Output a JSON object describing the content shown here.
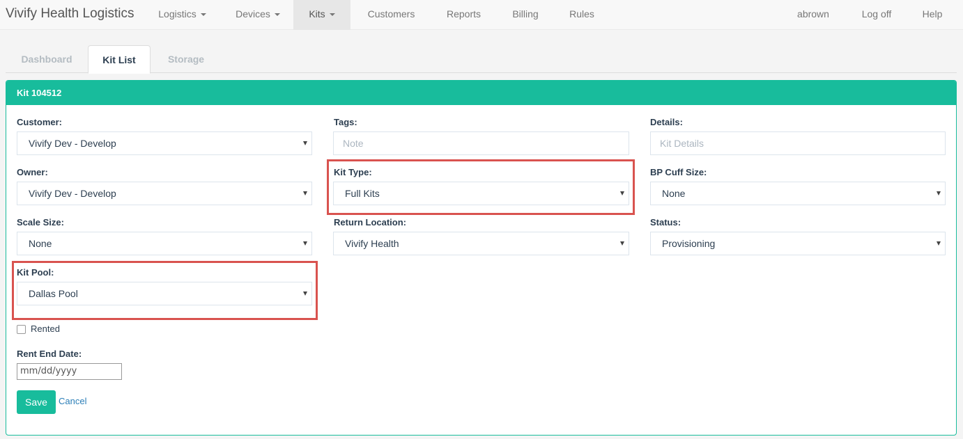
{
  "navbar": {
    "brand": "Vivify Health Logistics",
    "items": [
      {
        "label": "Logistics"
      },
      {
        "label": "Devices"
      },
      {
        "label": "Kits"
      },
      {
        "label": "Customers"
      },
      {
        "label": "Reports"
      },
      {
        "label": "Billing"
      },
      {
        "label": "Rules"
      }
    ],
    "user": "abrown",
    "logoff": "Log off",
    "help": "Help"
  },
  "tabs": [
    {
      "label": "Dashboard"
    },
    {
      "label": "Kit List"
    },
    {
      "label": "Storage"
    }
  ],
  "panel": {
    "title": "Kit 104512"
  },
  "form": {
    "customer": {
      "label": "Customer:",
      "value": "Vivify Dev - Develop"
    },
    "tags": {
      "label": "Tags:",
      "placeholder": "Note"
    },
    "details": {
      "label": "Details:",
      "placeholder": "Kit Details"
    },
    "owner": {
      "label": "Owner:",
      "value": "Vivify Dev - Develop"
    },
    "kit_type": {
      "label": "Kit Type:",
      "value": "Full Kits"
    },
    "bp_cuff": {
      "label": "BP Cuff Size:",
      "value": "None"
    },
    "scale_size": {
      "label": "Scale Size:",
      "value": "None"
    },
    "return_location": {
      "label": "Return Location:",
      "value": "Vivify Health"
    },
    "status": {
      "label": "Status:",
      "value": "Provisioning"
    },
    "kit_pool": {
      "label": "Kit Pool:",
      "value": "Dallas Pool"
    },
    "rented": {
      "label": "Rented"
    },
    "rent_end": {
      "label": "Rent End Date:",
      "placeholder": "mm/dd/yyyy"
    },
    "save": "Save",
    "cancel": "Cancel"
  },
  "colors": {
    "accent": "#18bc9c",
    "highlight": "#d9534f",
    "link": "#2c7fb8"
  }
}
